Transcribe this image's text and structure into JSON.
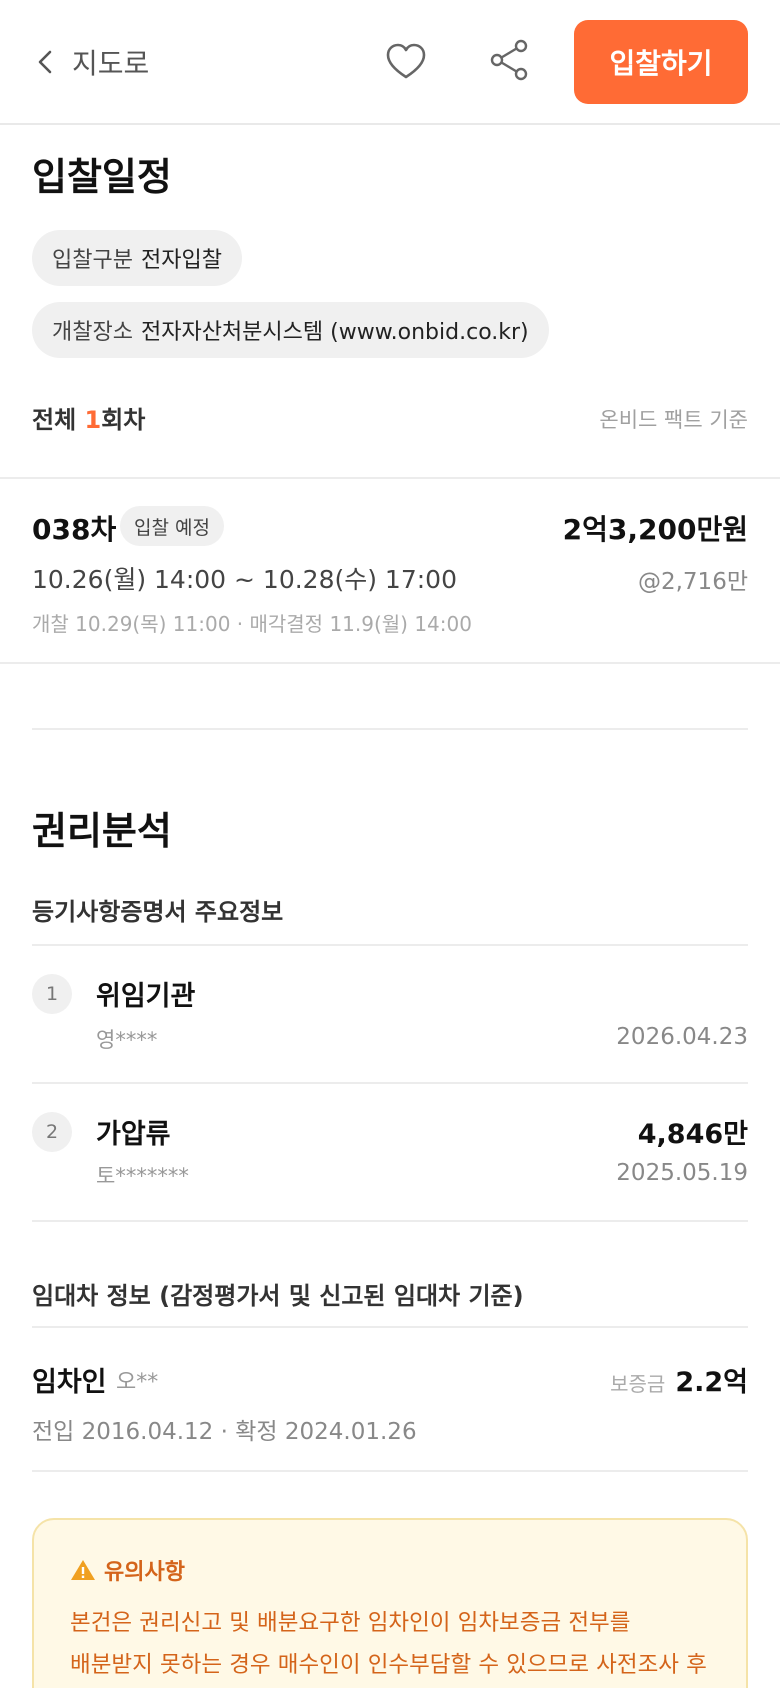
{
  "header": {
    "back_label": "지도로",
    "bid_button": "입찰하기"
  },
  "schedule": {
    "title": "입찰일정",
    "type_label": "입찰구분",
    "type_value": "전자입찰",
    "place_label": "개찰장소",
    "place_value": "전자자산처분시스템 (www.onbid.co.kr)",
    "total_prefix": "전체 ",
    "total_count": "1",
    "total_suffix": "회차",
    "note": "온비드 팩트 기준",
    "round": {
      "number": "038차",
      "status": "입찰 예정",
      "price": "2억3,200만원",
      "period": "10.26(월) 14:00 ~ 10.28(수) 17:00",
      "unit_price": "@2,716만",
      "open_info": "개찰 10.29(목) 11:00 · 매각결정 11.9(월) 14:00"
    }
  },
  "rights": {
    "title": "권리분석",
    "registry_title": "등기사항증명서 주요정보",
    "items": [
      {
        "no": "1",
        "title": "위임기관",
        "sub": "영****",
        "amount": "",
        "date": "2026.04.23"
      },
      {
        "no": "2",
        "title": "가압류",
        "sub": "토*******",
        "amount": "4,846만",
        "date": "2025.05.19"
      }
    ],
    "lease_title": "임대차 정보 (감정평가서 및 신고된 임대차 기준)",
    "tenant": {
      "label": "임차인",
      "name": "오**",
      "deposit_label": "보증금",
      "deposit_value": "2.2억",
      "dates": "전입 2016.04.12 · 확정 2024.01.26"
    }
  },
  "warning": {
    "title": "유의사항",
    "body": "본건은 권리신고 및 배분요구한 임차인이 임차보증금 전부를 배분받지 못하는 경우 매수인이 인수부담할 수 있으므로 사전조사 후 입",
    "color": "#d4641a"
  },
  "colors": {
    "accent": "#ff6b35",
    "warning_bg": "#fff9e6",
    "warning_border": "#f5e3a8"
  }
}
